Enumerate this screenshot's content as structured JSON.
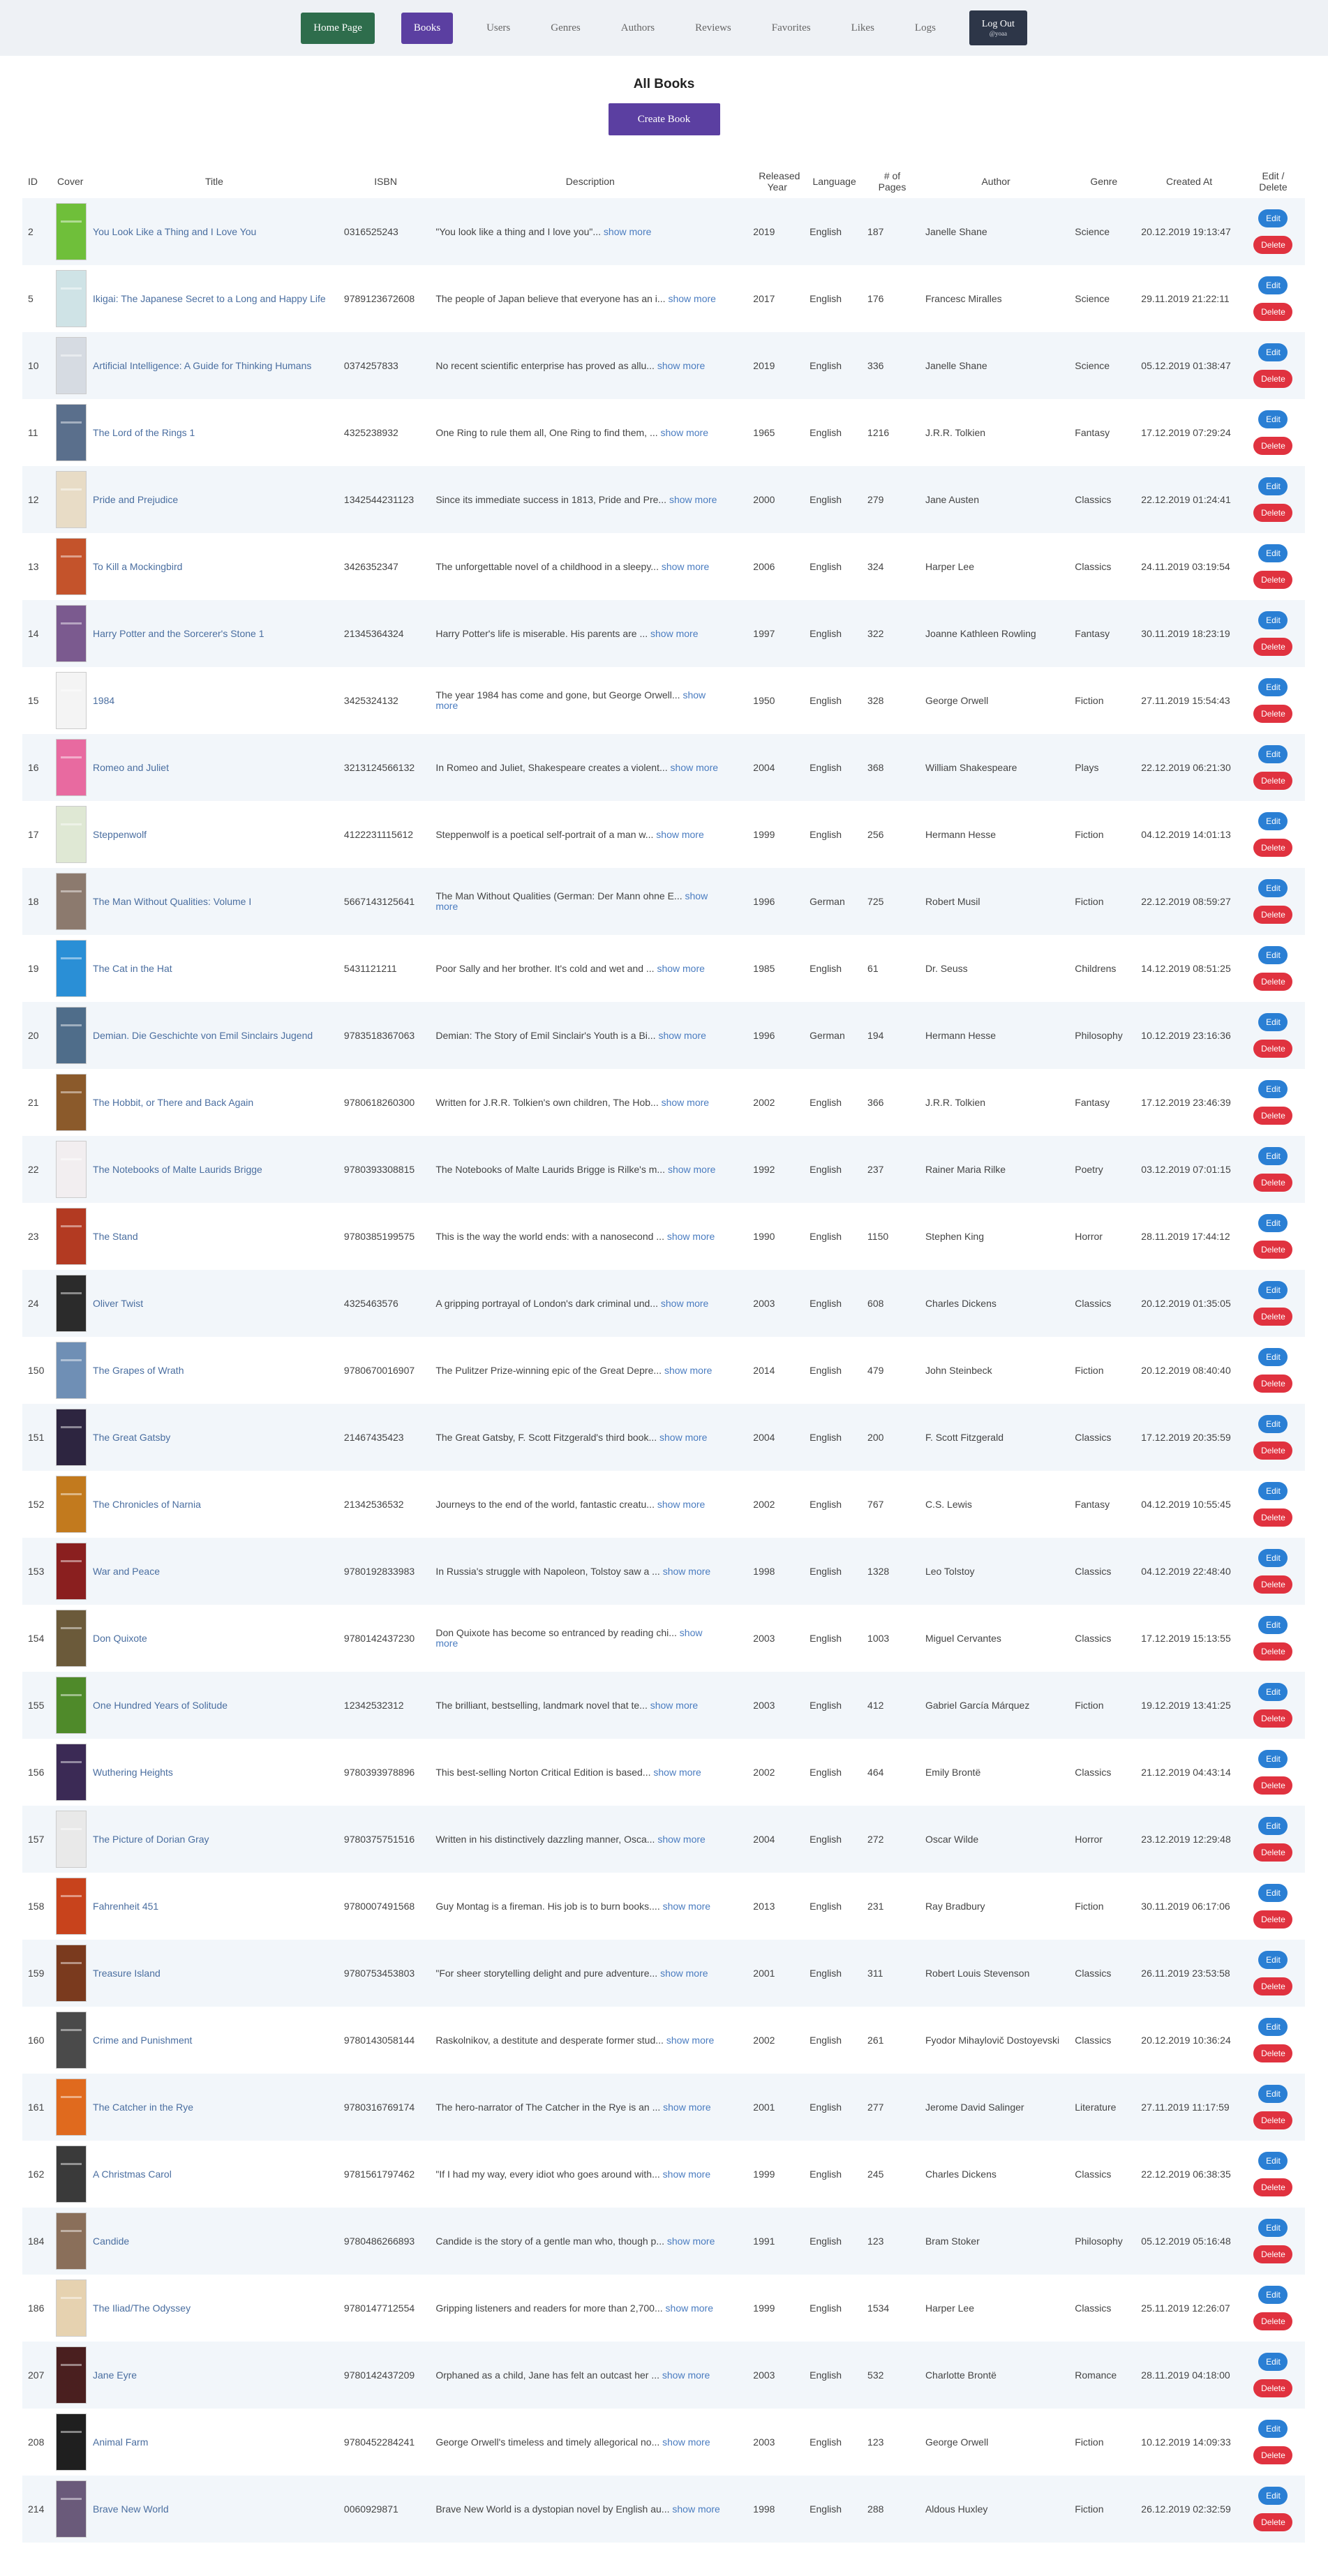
{
  "nav": {
    "home": "Home Page",
    "books": "Books",
    "users": "Users",
    "genres": "Genres",
    "authors": "Authors",
    "reviews": "Reviews",
    "favorites": "Favorites",
    "likes": "Likes",
    "logs": "Logs",
    "logout": "Log Out",
    "username": "@yoaa"
  },
  "page": {
    "title": "All Books",
    "create_label": "Create Book"
  },
  "table": {
    "headers": {
      "id": "ID",
      "cover": "Cover",
      "title": "Title",
      "isbn": "ISBN",
      "description": "Description",
      "year": "Released Year",
      "language": "Language",
      "pages": "# of Pages",
      "author": "Author",
      "genre": "Genre",
      "created": "Created At",
      "actions": "Edit / Delete"
    },
    "show_more": "show more",
    "edit_label": "Edit",
    "delete_label": "Delete",
    "rows": [
      {
        "id": "2",
        "cover": "#6fbf3a",
        "title": "You Look Like a Thing and I Love You",
        "isbn": "0316525243",
        "desc": "\"You look like a thing and I love you\"...",
        "year": "2019",
        "lang": "English",
        "pages": "187",
        "author": "Janelle Shane",
        "genre": "Science",
        "created": "20.12.2019 19:13:47"
      },
      {
        "id": "5",
        "cover": "#cfe3e6",
        "title": "Ikigai: The Japanese Secret to a Long and Happy Life",
        "isbn": "9789123672608",
        "desc": "The people of Japan believe that everyone has an i...",
        "year": "2017",
        "lang": "English",
        "pages": "176",
        "author": "Francesc Miralles",
        "genre": "Science",
        "created": "29.11.2019 21:22:11"
      },
      {
        "id": "10",
        "cover": "#d6dbe2",
        "title": "Artificial Intelligence: A Guide for Thinking Humans",
        "isbn": "0374257833",
        "desc": "No recent scientific enterprise has proved as allu...",
        "year": "2019",
        "lang": "English",
        "pages": "336",
        "author": "Janelle Shane",
        "genre": "Science",
        "created": "05.12.2019 01:38:47"
      },
      {
        "id": "11",
        "cover": "#5a6f8c",
        "title": "The Lord of the Rings 1",
        "isbn": "4325238932",
        "desc": "One Ring to rule them all, One Ring to find them, ...",
        "year": "1965",
        "lang": "English",
        "pages": "1216",
        "author": "J.R.R. Tolkien",
        "genre": "Fantasy",
        "created": "17.12.2019 07:29:24"
      },
      {
        "id": "12",
        "cover": "#e8dcc6",
        "title": "Pride and Prejudice",
        "isbn": "1342544231123",
        "desc": "Since its immediate success in 1813, Pride and Pre...",
        "year": "2000",
        "lang": "English",
        "pages": "279",
        "author": "Jane Austen",
        "genre": "Classics",
        "created": "22.12.2019 01:24:41"
      },
      {
        "id": "13",
        "cover": "#c4532b",
        "title": "To Kill a Mockingbird",
        "isbn": "3426352347",
        "desc": "The unforgettable novel of a childhood in a sleepy...",
        "year": "2006",
        "lang": "English",
        "pages": "324",
        "author": "Harper Lee",
        "genre": "Classics",
        "created": "24.11.2019 03:19:54"
      },
      {
        "id": "14",
        "cover": "#7b5a8f",
        "title": "Harry Potter and the Sorcerer's Stone 1",
        "isbn": "21345364324",
        "desc": "Harry Potter's life is miserable. His parents are ...",
        "year": "1997",
        "lang": "English",
        "pages": "322",
        "author": "Joanne Kathleen Rowling",
        "genre": "Fantasy",
        "created": "30.11.2019 18:23:19"
      },
      {
        "id": "15",
        "cover": "#f4f4f4",
        "title": "1984",
        "isbn": "3425324132",
        "desc": "The year 1984 has come and gone, but George Orwell...",
        "year": "1950",
        "lang": "English",
        "pages": "328",
        "author": "George Orwell",
        "genre": "Fiction",
        "created": "27.11.2019 15:54:43"
      },
      {
        "id": "16",
        "cover": "#e86aa0",
        "title": "Romeo and Juliet",
        "isbn": "3213124566132",
        "desc": "In Romeo and Juliet, Shakespeare creates a violent...",
        "year": "2004",
        "lang": "English",
        "pages": "368",
        "author": "William Shakespeare",
        "genre": "Plays",
        "created": "22.12.2019 06:21:30"
      },
      {
        "id": "17",
        "cover": "#dfe8d4",
        "title": "Steppenwolf",
        "isbn": "4122231115612",
        "desc": "Steppenwolf is a poetical self-portrait of a man w...",
        "year": "1999",
        "lang": "English",
        "pages": "256",
        "author": "Hermann Hesse",
        "genre": "Fiction",
        "created": "04.12.2019 14:01:13"
      },
      {
        "id": "18",
        "cover": "#8c7a6e",
        "title": "The Man Without Qualities: Volume I",
        "isbn": "5667143125641",
        "desc": "The Man Without Qualities (German: Der Mann ohne E...",
        "year": "1996",
        "lang": "German",
        "pages": "725",
        "author": "Robert Musil",
        "genre": "Fiction",
        "created": "22.12.2019 08:59:27"
      },
      {
        "id": "19",
        "cover": "#2a8fd6",
        "title": "The Cat in the Hat",
        "isbn": "5431121211",
        "desc": "Poor Sally and her brother. It's cold and wet and ...",
        "year": "1985",
        "lang": "English",
        "pages": "61",
        "author": "Dr. Seuss",
        "genre": "Childrens",
        "created": "14.12.2019 08:51:25"
      },
      {
        "id": "20",
        "cover": "#4f6d8a",
        "title": "Demian. Die Geschichte von Emil Sinclairs Jugend",
        "isbn": "9783518367063",
        "desc": "Demian: The Story of Emil Sinclair's Youth is a Bi...",
        "year": "1996",
        "lang": "German",
        "pages": "194",
        "author": "Hermann Hesse",
        "genre": "Philosophy",
        "created": "10.12.2019 23:16:36"
      },
      {
        "id": "21",
        "cover": "#8b5a2b",
        "title": "The Hobbit, or There and Back Again",
        "isbn": "9780618260300",
        "desc": "Written for J.R.R. Tolkien's own children, The Hob...",
        "year": "2002",
        "lang": "English",
        "pages": "366",
        "author": "J.R.R. Tolkien",
        "genre": "Fantasy",
        "created": "17.12.2019 23:46:39"
      },
      {
        "id": "22",
        "cover": "#f2eef0",
        "title": "The Notebooks of Malte Laurids Brigge",
        "isbn": "9780393308815",
        "desc": "The Notebooks of Malte Laurids Brigge is Rilke's m...",
        "year": "1992",
        "lang": "English",
        "pages": "237",
        "author": "Rainer Maria Rilke",
        "genre": "Poetry",
        "created": "03.12.2019 07:01:15"
      },
      {
        "id": "23",
        "cover": "#b33a22",
        "title": "The Stand",
        "isbn": "9780385199575",
        "desc": "This is the way the world ends: with a nanosecond ...",
        "year": "1990",
        "lang": "English",
        "pages": "1150",
        "author": "Stephen King",
        "genre": "Horror",
        "created": "28.11.2019 17:44:12"
      },
      {
        "id": "24",
        "cover": "#2b2b2b",
        "title": "Oliver Twist",
        "isbn": "4325463576",
        "desc": "A gripping portrayal of London's dark criminal und...",
        "year": "2003",
        "lang": "English",
        "pages": "608",
        "author": "Charles Dickens",
        "genre": "Classics",
        "created": "20.12.2019 01:35:05"
      },
      {
        "id": "150",
        "cover": "#6f8fb5",
        "title": "The Grapes of Wrath",
        "isbn": "9780670016907",
        "desc": "The Pulitzer Prize-winning epic of the Great Depre...",
        "year": "2014",
        "lang": "English",
        "pages": "479",
        "author": "John Steinbeck",
        "genre": "Fiction",
        "created": "20.12.2019 08:40:40"
      },
      {
        "id": "151",
        "cover": "#2d2540",
        "title": "The Great Gatsby",
        "isbn": "21467435423",
        "desc": "The Great Gatsby, F. Scott Fitzgerald's third book...",
        "year": "2004",
        "lang": "English",
        "pages": "200",
        "author": "F. Scott Fitzgerald",
        "genre": "Classics",
        "created": "17.12.2019 20:35:59"
      },
      {
        "id": "152",
        "cover": "#c27a1e",
        "title": "The Chronicles of Narnia",
        "isbn": "21342536532",
        "desc": "Journeys to the end of the world, fantastic creatu...",
        "year": "2002",
        "lang": "English",
        "pages": "767",
        "author": "C.S. Lewis",
        "genre": "Fantasy",
        "created": "04.12.2019 10:55:45"
      },
      {
        "id": "153",
        "cover": "#8a1f1f",
        "title": "War and Peace",
        "isbn": "9780192833983",
        "desc": "In Russia's struggle with Napoleon, Tolstoy saw a ...",
        "year": "1998",
        "lang": "English",
        "pages": "1328",
        "author": "Leo Tolstoy",
        "genre": "Classics",
        "created": "04.12.2019 22:48:40"
      },
      {
        "id": "154",
        "cover": "#6b5a3a",
        "title": "Don Quixote",
        "isbn": "9780142437230",
        "desc": "Don Quixote has become so entranced by reading chi...",
        "year": "2003",
        "lang": "English",
        "pages": "1003",
        "author": "Miguel Cervantes",
        "genre": "Classics",
        "created": "17.12.2019 15:13:55"
      },
      {
        "id": "155",
        "cover": "#4f8a2a",
        "title": "One Hundred Years of Solitude",
        "isbn": "12342532312",
        "desc": "The brilliant, bestselling, landmark novel that te...",
        "year": "2003",
        "lang": "English",
        "pages": "412",
        "author": "Gabriel García Márquez",
        "genre": "Fiction",
        "created": "19.12.2019 13:41:25"
      },
      {
        "id": "156",
        "cover": "#3b2a55",
        "title": "Wuthering Heights",
        "isbn": "9780393978896",
        "desc": "This best-selling Norton Critical Edition is based...",
        "year": "2002",
        "lang": "English",
        "pages": "464",
        "author": "Emily Brontë",
        "genre": "Classics",
        "created": "21.12.2019 04:43:14"
      },
      {
        "id": "157",
        "cover": "#e9e9e9",
        "title": "The Picture of Dorian Gray",
        "isbn": "9780375751516",
        "desc": "Written in his distinctively dazzling manner, Osca...",
        "year": "2004",
        "lang": "English",
        "pages": "272",
        "author": "Oscar Wilde",
        "genre": "Horror",
        "created": "23.12.2019 12:29:48"
      },
      {
        "id": "158",
        "cover": "#c8431c",
        "title": "Fahrenheit 451",
        "isbn": "9780007491568",
        "desc": "Guy Montag is a fireman. His job is to burn books....",
        "year": "2013",
        "lang": "English",
        "pages": "231",
        "author": "Ray Bradbury",
        "genre": "Fiction",
        "created": "30.11.2019 06:17:06"
      },
      {
        "id": "159",
        "cover": "#7a3a1e",
        "title": "Treasure Island",
        "isbn": "9780753453803",
        "desc": "\"For sheer storytelling delight and pure adventure...",
        "year": "2001",
        "lang": "English",
        "pages": "311",
        "author": "Robert Louis Stevenson",
        "genre": "Classics",
        "created": "26.11.2019 23:53:58"
      },
      {
        "id": "160",
        "cover": "#4a4a4a",
        "title": "Crime and Punishment",
        "isbn": "9780143058144",
        "desc": "Raskolnikov, a destitute and desperate former stud...",
        "year": "2002",
        "lang": "English",
        "pages": "261",
        "author": "Fyodor Mihaylovič Dostoyevski",
        "genre": "Classics",
        "created": "20.12.2019 10:36:24"
      },
      {
        "id": "161",
        "cover": "#e06a1e",
        "title": "The Catcher in the Rye",
        "isbn": "9780316769174",
        "desc": "The hero-narrator of The Catcher in the Rye is an ...",
        "year": "2001",
        "lang": "English",
        "pages": "277",
        "author": "Jerome David Salinger",
        "genre": "Literature",
        "created": "27.11.2019 11:17:59"
      },
      {
        "id": "162",
        "cover": "#3a3a3a",
        "title": "A Christmas Carol",
        "isbn": "9781561797462",
        "desc": "\"If I had my way, every idiot who goes around with...",
        "year": "1999",
        "lang": "English",
        "pages": "245",
        "author": "Charles Dickens",
        "genre": "Classics",
        "created": "22.12.2019 06:38:35"
      },
      {
        "id": "184",
        "cover": "#8a6f5a",
        "title": "Candide",
        "isbn": "9780486266893",
        "desc": "Candide is the story of a gentle man who, though p...",
        "year": "1991",
        "lang": "English",
        "pages": "123",
        "author": "Bram Stoker",
        "genre": "Philosophy",
        "created": "05.12.2019 05:16:48"
      },
      {
        "id": "186",
        "cover": "#e6d2b0",
        "title": "The Iliad/The Odyssey",
        "isbn": "9780147712554",
        "desc": "Gripping listeners and readers for more than 2,700...",
        "year": "1999",
        "lang": "English",
        "pages": "1534",
        "author": "Harper Lee",
        "genre": "Classics",
        "created": "25.11.2019 12:26:07"
      },
      {
        "id": "207",
        "cover": "#4a1f1f",
        "title": "Jane Eyre",
        "isbn": "9780142437209",
        "desc": "Orphaned as a child, Jane has felt an outcast her ...",
        "year": "2003",
        "lang": "English",
        "pages": "532",
        "author": "Charlotte Brontë",
        "genre": "Romance",
        "created": "28.11.2019 04:18:00"
      },
      {
        "id": "208",
        "cover": "#1f1f1f",
        "title": "Animal Farm",
        "isbn": "9780452284241",
        "desc": "George Orwell's timeless and timely allegorical no...",
        "year": "2003",
        "lang": "English",
        "pages": "123",
        "author": "George Orwell",
        "genre": "Fiction",
        "created": "10.12.2019 14:09:33"
      },
      {
        "id": "214",
        "cover": "#6a5a7a",
        "title": "Brave New World",
        "isbn": "0060929871",
        "desc": "Brave New World is a dystopian novel by English au...",
        "year": "1998",
        "lang": "English",
        "pages": "288",
        "author": "Aldous Huxley",
        "genre": "Fiction",
        "created": "26.12.2019 02:32:59"
      }
    ]
  }
}
